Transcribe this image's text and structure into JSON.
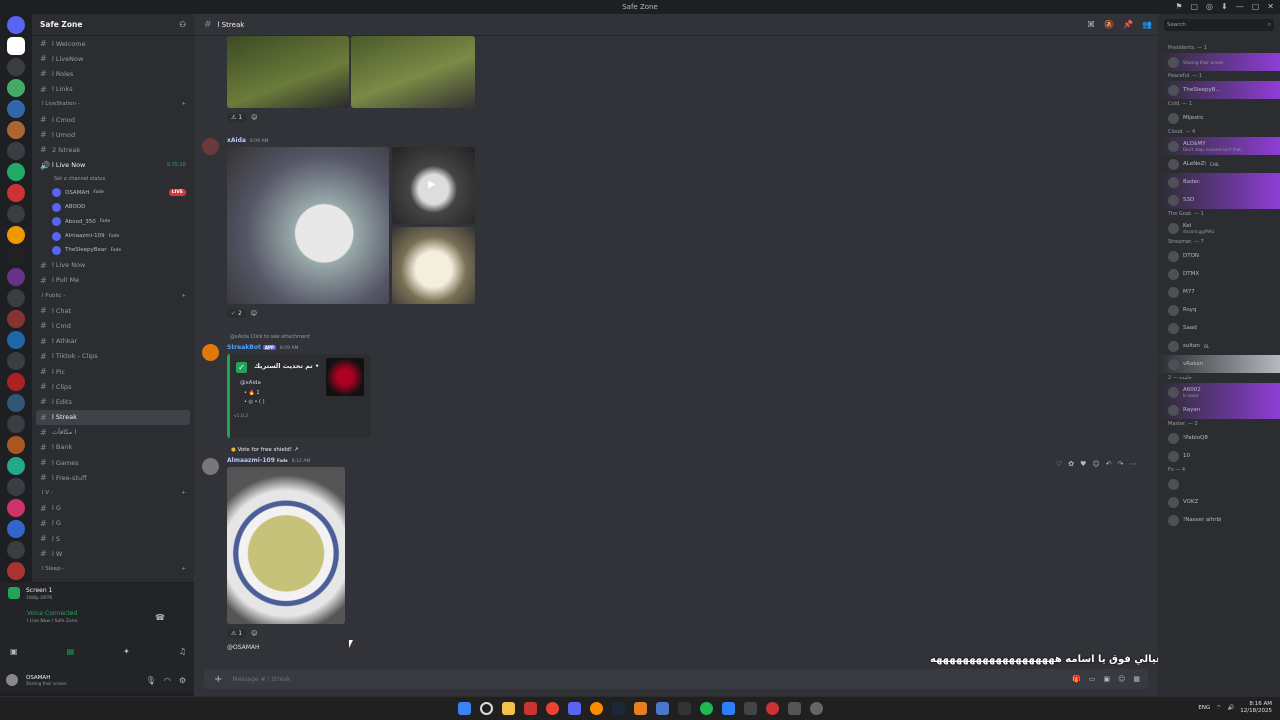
{
  "window": {
    "title": "Safe Zone"
  },
  "titlebar_icons": [
    "⚑",
    "▢",
    "◎",
    "⬇",
    "—",
    "▢",
    "✕"
  ],
  "server": {
    "name": "Safe Zone"
  },
  "channels": [
    {
      "type": "chan",
      "label": "ا Welcome"
    },
    {
      "type": "chan",
      "label": "ا LiveNow"
    },
    {
      "type": "chan",
      "label": "ا Roles"
    },
    {
      "type": "chan",
      "label": "ا Links"
    },
    {
      "type": "cat",
      "label": "ا LiveStation -"
    },
    {
      "type": "chan",
      "label": "ا Cmod"
    },
    {
      "type": "chan",
      "label": "ا Umod"
    },
    {
      "type": "chan",
      "label": "ا 2streak"
    },
    {
      "type": "live",
      "label": "ا Live Now",
      "timer": "9:35:26"
    },
    {
      "type": "sub",
      "label": "Set a channel status"
    }
  ],
  "voice_users": [
    {
      "name": "OSAMAH",
      "tag": "Fade",
      "live": "LIVE"
    },
    {
      "name": "ABOOD"
    },
    {
      "name": "Abood_350",
      "tag": "Fade"
    },
    {
      "name": "Almaazmi-109",
      "tag": "Fade"
    },
    {
      "name": "TheSleepyBear",
      "tag": "Fade"
    }
  ],
  "channels2": [
    {
      "type": "chan",
      "label": "ا Live Now"
    },
    {
      "type": "chan",
      "label": "ا Pull Me"
    },
    {
      "type": "cat",
      "label": "ا Public -"
    },
    {
      "type": "chan",
      "label": "ا Chat"
    },
    {
      "type": "chan",
      "label": "ا Cmd"
    },
    {
      "type": "chan",
      "label": "ا Athkar"
    },
    {
      "type": "chan",
      "label": "ا Tiktok - Clips"
    },
    {
      "type": "chan",
      "label": "ا Pic"
    },
    {
      "type": "chan",
      "label": "ا Clips"
    },
    {
      "type": "chan",
      "label": "ا Edits"
    },
    {
      "type": "active",
      "label": "ا Streak"
    },
    {
      "type": "chan",
      "label": "ا مكافآت"
    },
    {
      "type": "chan",
      "label": "ا Bank"
    },
    {
      "type": "chan",
      "label": "ا Games"
    },
    {
      "type": "chan",
      "label": "ا Free-stuff"
    },
    {
      "type": "cat",
      "label": "ا V -"
    },
    {
      "type": "chan",
      "label": "ا G"
    },
    {
      "type": "chan",
      "label": "ا G"
    },
    {
      "type": "chan",
      "label": "ا S"
    },
    {
      "type": "chan",
      "label": "ا W"
    },
    {
      "type": "cat",
      "label": "ا Sleep -"
    }
  ],
  "screen": {
    "title": "Screen 1",
    "sub": "1080p 30FPS",
    "voice": "Voice Connected",
    "voice_sub": "ا Live Now / Safe Zone"
  },
  "user": {
    "name": "OSAMAH",
    "status": "Sharing their screen"
  },
  "header": {
    "channel": "ا Streak"
  },
  "messages": [
    {
      "react": "1"
    },
    {
      "user": "xAida",
      "ts": "8:09 AM",
      "react": "2"
    },
    {
      "reply": "@xAida  Click to see attachment",
      "user": "StreakBot",
      "app": "APP",
      "ts": "8:09 AM",
      "embed_title": "تم تحديث الستريك •",
      "embed_mention": "@xAida",
      "embed_line1": "1",
      "embed_ver": "v1.0.2",
      "vote": "Vote for free shield!"
    },
    {
      "user": "Almaazmi-109",
      "tag": "Fade",
      "ts": "8:12 AM",
      "react": "1",
      "mention": "@OSAMAH"
    }
  ],
  "composer": {
    "placeholder": "Message # ا Streak"
  },
  "subtitle": "شوف عيالي فوق يا اسامه هههههههههههههههههههه : xAiida",
  "members": {
    "search": "Search",
    "groups": [
      {
        "title": "Presidents. — 1",
        "items": [
          {
            "name": "",
            "sub": "Sharing their screen",
            "hl": "p"
          }
        ]
      },
      {
        "title": "Peaceful. — 1",
        "items": [
          {
            "name": "TheSleepyB...",
            "hl": "p"
          }
        ]
      },
      {
        "title": "Cold. — 1",
        "items": [
          {
            "name": "Mljestic"
          }
        ]
      },
      {
        "title": "Cloud. — 4",
        "items": [
          {
            "name": "ALD$MY",
            "sub": "Don't stop, success isn't that...",
            "hl": "p"
          },
          {
            "name": "ALeNeZi",
            "tag": "CHIL"
          },
          {
            "name": "Bader.",
            "hl": "p"
          },
          {
            "name": "S3D",
            "hl": "p"
          }
        ]
      },
      {
        "title": "The Goat. — 1",
        "items": [
          {
            "name": "Kel",
            "sub": "discord.gg/MAU"
          }
        ]
      },
      {
        "title": "Streamer. — 7",
        "items": [
          {
            "name": "DTON"
          },
          {
            "name": "DTMX"
          },
          {
            "name": "M77"
          },
          {
            "name": "Rsyq"
          },
          {
            "name": "Saad"
          },
          {
            "name": "sultan",
            "tag": "OL"
          },
          {
            "name": "vRakan",
            "hl": "g"
          }
        ]
      },
      {
        "title": "جامده — 2",
        "items": [
          {
            "name": "A6002",
            "sub": "In voice",
            "hl": "p"
          },
          {
            "name": "Rayan",
            "hl": "p"
          }
        ]
      },
      {
        "title": "Master. — 2",
        "items": [
          {
            "name": "!PabloQ8"
          },
          {
            "name": "10"
          }
        ]
      },
      {
        "title": "Fo — 4",
        "items": [
          {
            "name": ""
          },
          {
            "name": "VOKZ"
          },
          {
            "name": "!Nasser alhrbi"
          }
        ]
      }
    ]
  },
  "tray": {
    "lang": "ENG",
    "time": "8:16 AM",
    "date": "12/18/2025"
  }
}
